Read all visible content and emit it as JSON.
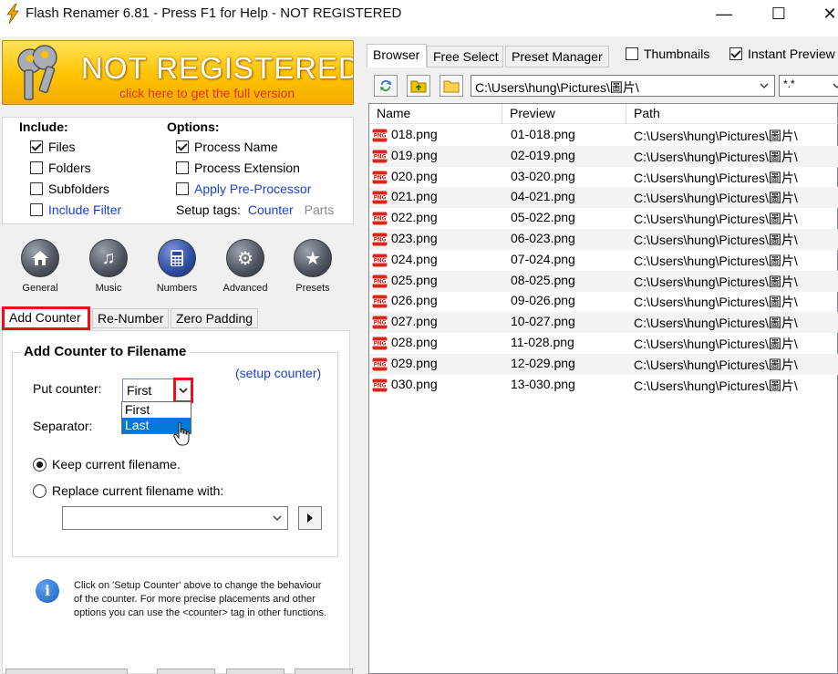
{
  "window": {
    "title": "Flash Renamer 6.81 - Press F1 for Help - NOT REGISTERED",
    "minimize": "—",
    "maximize": "☐",
    "close": "✕"
  },
  "banner": {
    "title": "NOT REGISTERED",
    "subtitle": "click here to get the full version"
  },
  "include": {
    "heading": "Include:",
    "items": [
      {
        "label": "Files",
        "checked": true
      },
      {
        "label": "Folders",
        "checked": false
      },
      {
        "label": "Subfolders",
        "checked": false
      },
      {
        "label": "Include Filter",
        "checked": false
      }
    ]
  },
  "options": {
    "heading": "Options:",
    "items": [
      {
        "label": "Process Name",
        "checked": true
      },
      {
        "label": "Process Extension",
        "checked": false
      },
      {
        "label": "Apply Pre-Processor",
        "checked": false
      }
    ],
    "setup_tags_label": "Setup tags:",
    "setup_tags_counter": "Counter",
    "setup_tags_parts": "Parts"
  },
  "categories": [
    {
      "label": "General",
      "icon": "house-icon"
    },
    {
      "label": "Music",
      "icon": "music-note-icon"
    },
    {
      "label": "Numbers",
      "icon": "calculator-icon"
    },
    {
      "label": "Advanced",
      "icon": "gear-icon"
    },
    {
      "label": "Presets",
      "icon": "star-icon"
    }
  ],
  "tabs": [
    "Add Counter",
    "Re-Number",
    "Zero Padding"
  ],
  "counter_panel": {
    "group_title": "Add Counter to Filename",
    "setup_link": "(setup counter)",
    "put_counter_label": "Put counter:",
    "put_counter_value": "First",
    "dropdown_options": [
      "First",
      "Last"
    ],
    "separator_label": "Separator:",
    "keep_label": "Keep current filename.",
    "replace_label": "Replace current filename with:",
    "replace_value": ""
  },
  "info": {
    "text": "Click on 'Setup Counter' above to change the behaviour of the counter. For more precise placements and other options you can use the <counter> tag in other functions."
  },
  "browser": {
    "tabs": [
      "Browser",
      "Free Select",
      "Preset Manager"
    ],
    "thumbnails_label": "Thumbnails",
    "thumbnails_checked": false,
    "instant_preview_label": "Instant Preview",
    "instant_preview_checked": true,
    "path": "C:\\Users\\hung\\Pictures\\圖片\\",
    "mask": "*.*",
    "columns": [
      "Name",
      "Preview",
      "Path"
    ],
    "files": [
      {
        "name": "018.png",
        "preview": "01-018.png",
        "path": "C:\\Users\\hung\\Pictures\\圖片\\"
      },
      {
        "name": "019.png",
        "preview": "02-019.png",
        "path": "C:\\Users\\hung\\Pictures\\圖片\\"
      },
      {
        "name": "020.png",
        "preview": "03-020.png",
        "path": "C:\\Users\\hung\\Pictures\\圖片\\"
      },
      {
        "name": "021.png",
        "preview": "04-021.png",
        "path": "C:\\Users\\hung\\Pictures\\圖片\\"
      },
      {
        "name": "022.png",
        "preview": "05-022.png",
        "path": "C:\\Users\\hung\\Pictures\\圖片\\"
      },
      {
        "name": "023.png",
        "preview": "06-023.png",
        "path": "C:\\Users\\hung\\Pictures\\圖片\\"
      },
      {
        "name": "024.png",
        "preview": "07-024.png",
        "path": "C:\\Users\\hung\\Pictures\\圖片\\"
      },
      {
        "name": "025.png",
        "preview": "08-025.png",
        "path": "C:\\Users\\hung\\Pictures\\圖片\\"
      },
      {
        "name": "026.png",
        "preview": "09-026.png",
        "path": "C:\\Users\\hung\\Pictures\\圖片\\"
      },
      {
        "name": "027.png",
        "preview": "10-027.png",
        "path": "C:\\Users\\hung\\Pictures\\圖片\\"
      },
      {
        "name": "028.png",
        "preview": "11-028.png",
        "path": "C:\\Users\\hung\\Pictures\\圖片\\"
      },
      {
        "name": "029.png",
        "preview": "12-029.png",
        "path": "C:\\Users\\hung\\Pictures\\圖片\\"
      },
      {
        "name": "030.png",
        "preview": "13-030.png",
        "path": "C:\\Users\\hung\\Pictures\\圖片\\"
      }
    ]
  },
  "colors": {
    "highlight_red": "#e8101e",
    "link_blue": "#1a3fd8",
    "banner_yellow": "#ffc300",
    "selection_blue": "#0078d7"
  }
}
